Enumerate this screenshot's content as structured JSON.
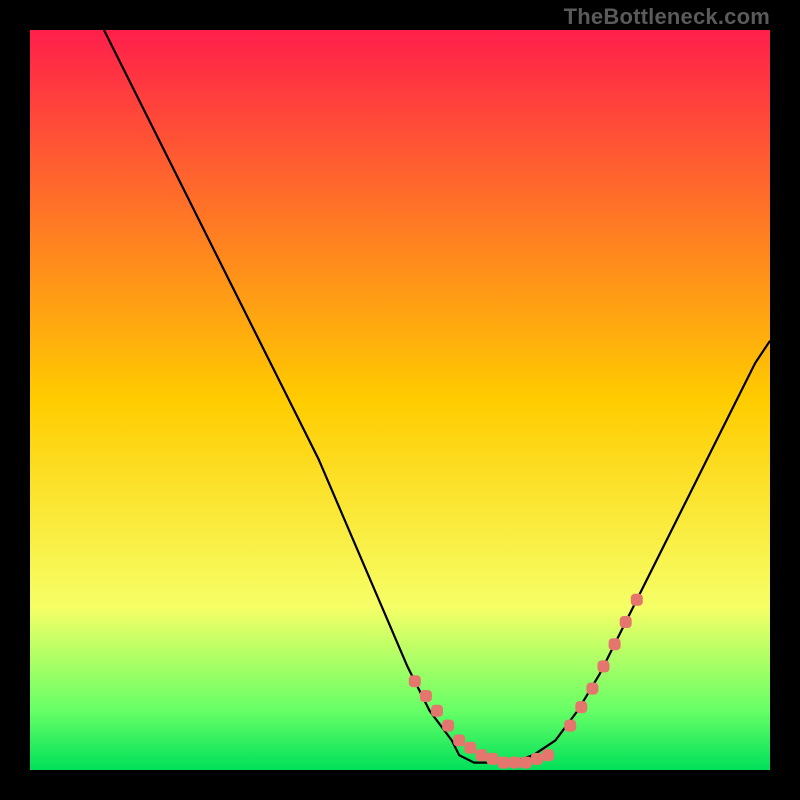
{
  "watermark": "TheBottleneck.com",
  "colors": {
    "frame": "#000000",
    "gradient_top": "#ff1f4b",
    "gradient_mid": "#ffcc00",
    "gradient_low": "#f6ff66",
    "gradient_green_light": "#66ff66",
    "gradient_green": "#00e05a",
    "curve": "#000000",
    "markers": "#e4766e"
  },
  "chart_data": {
    "type": "line",
    "title": "",
    "xlabel": "",
    "ylabel": "",
    "xlim": [
      0,
      100
    ],
    "ylim": [
      0,
      100
    ],
    "grid": false,
    "series": [
      {
        "name": "bottleneck-curve",
        "x": [
          10,
          12,
          15,
          18,
          21,
          24,
          27,
          30,
          33,
          36,
          39,
          42,
          45,
          48,
          51,
          54,
          57,
          58,
          60,
          62,
          65,
          68,
          71,
          74,
          77,
          80,
          83,
          86,
          89,
          92,
          95,
          98,
          100
        ],
        "values": [
          100,
          96,
          90,
          84,
          78,
          72,
          66,
          60,
          54,
          48,
          42,
          35,
          28,
          21,
          14,
          8,
          4,
          2,
          1,
          1,
          1,
          2,
          4,
          8,
          13,
          19,
          25,
          31,
          37,
          43,
          49,
          55,
          58
        ]
      }
    ],
    "markers": {
      "name": "highlighted-points",
      "x": [
        52,
        53.5,
        55,
        56.5,
        58,
        59.5,
        61,
        62.5,
        64,
        65.5,
        67,
        68.5,
        70,
        73,
        74.5,
        76,
        77.5,
        79,
        80.5,
        82
      ],
      "values": [
        12,
        10,
        8,
        6,
        4,
        3,
        2,
        1.5,
        1,
        1,
        1,
        1.5,
        2,
        6,
        8.5,
        11,
        14,
        17,
        20,
        23
      ]
    }
  }
}
